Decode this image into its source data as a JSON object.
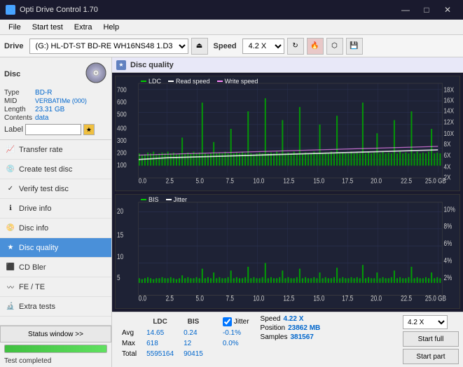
{
  "app": {
    "title": "Opti Drive Control 1.70",
    "icon": "ODC"
  },
  "titlebar": {
    "minimize": "—",
    "maximize": "□",
    "close": "✕"
  },
  "menu": {
    "items": [
      "File",
      "Start test",
      "Extra",
      "Help"
    ]
  },
  "drive_toolbar": {
    "drive_label": "Drive",
    "drive_value": "(G:)  HL-DT-ST BD-RE  WH16NS48 1.D3",
    "speed_label": "Speed",
    "speed_value": "4.2 X"
  },
  "sidebar": {
    "disc": {
      "type_label": "Type",
      "type_value": "BD-R",
      "mid_label": "MID",
      "mid_value": "VERBATIMe (000)",
      "length_label": "Length",
      "length_value": "23.31 GB",
      "contents_label": "Contents",
      "contents_value": "data",
      "label_label": "Label"
    },
    "nav_items": [
      {
        "id": "transfer-rate",
        "label": "Transfer rate",
        "icon": "📈"
      },
      {
        "id": "create-test-disc",
        "label": "Create test disc",
        "icon": "💿"
      },
      {
        "id": "verify-test-disc",
        "label": "Verify test disc",
        "icon": "✓"
      },
      {
        "id": "drive-info",
        "label": "Drive info",
        "icon": "ℹ"
      },
      {
        "id": "disc-info",
        "label": "Disc info",
        "icon": "📀"
      },
      {
        "id": "disc-quality",
        "label": "Disc quality",
        "icon": "★",
        "active": true
      },
      {
        "id": "cd-bler",
        "label": "CD Bler",
        "icon": "⬛"
      },
      {
        "id": "fe-te",
        "label": "FE / TE",
        "icon": "〰"
      },
      {
        "id": "extra-tests",
        "label": "Extra tests",
        "icon": "🔬"
      }
    ],
    "status_btn": "Status window >>",
    "status_text": "Test completed",
    "progress_pct": 100
  },
  "disc_quality": {
    "title": "Disc quality",
    "legend": {
      "ldc": "LDC",
      "read_speed": "Read speed",
      "write_speed": "Write speed",
      "bis": "BIS",
      "jitter": "Jitter"
    },
    "chart1": {
      "y_labels_left": [
        "700",
        "600",
        "500",
        "400",
        "300",
        "200",
        "100"
      ],
      "y_labels_right": [
        "18X",
        "16X",
        "14X",
        "12X",
        "10X",
        "8X",
        "6X",
        "4X",
        "2X"
      ],
      "x_labels": [
        "0.0",
        "2.5",
        "5.0",
        "7.5",
        "10.0",
        "12.5",
        "15.0",
        "17.5",
        "20.0",
        "22.5",
        "25.0 GB"
      ]
    },
    "chart2": {
      "y_labels_left": [
        "20",
        "15",
        "10",
        "5"
      ],
      "y_labels_right": [
        "10%",
        "8%",
        "6%",
        "4%",
        "2%"
      ],
      "x_labels": [
        "0.0",
        "2.5",
        "5.0",
        "7.5",
        "10.0",
        "12.5",
        "15.0",
        "17.5",
        "20.0",
        "22.5",
        "25.0 GB"
      ]
    },
    "stats": {
      "avg_label": "Avg",
      "max_label": "Max",
      "total_label": "Total",
      "ldc_avg": "14.65",
      "ldc_max": "618",
      "ldc_total": "5595164",
      "bis_avg": "0.24",
      "bis_max": "12",
      "bis_total": "90415",
      "jitter_avg": "-0.1%",
      "jitter_max": "0.0%",
      "jitter_total": "",
      "speed_label": "Speed",
      "speed_value": "4.22 X",
      "position_label": "Position",
      "position_value": "23862 MB",
      "samples_label": "Samples",
      "samples_value": "381567",
      "speed_select": "4.2 X"
    },
    "buttons": {
      "start_full": "Start full",
      "start_part": "Start part"
    }
  }
}
